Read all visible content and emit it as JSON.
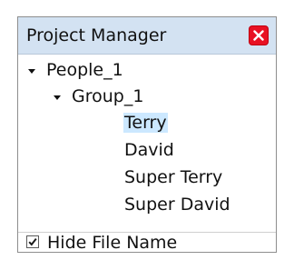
{
  "panel": {
    "title": "Project Manager",
    "close_icon": "close-icon"
  },
  "tree": {
    "root": {
      "label": "People_1",
      "expanded": true,
      "children": [
        {
          "label": "Group_1",
          "expanded": true,
          "children": [
            {
              "label": "Terry",
              "selected": true
            },
            {
              "label": "David",
              "selected": false
            },
            {
              "label": "Super Terry",
              "selected": false
            },
            {
              "label": "Super David",
              "selected": false
            }
          ]
        }
      ]
    }
  },
  "footer": {
    "hide_file_name_label": "Hide File Name",
    "hide_file_name_checked": true
  },
  "colors": {
    "titlebar_bg": "#d3e2f2",
    "close_button": "#e81123",
    "selection": "#cce8ff"
  }
}
